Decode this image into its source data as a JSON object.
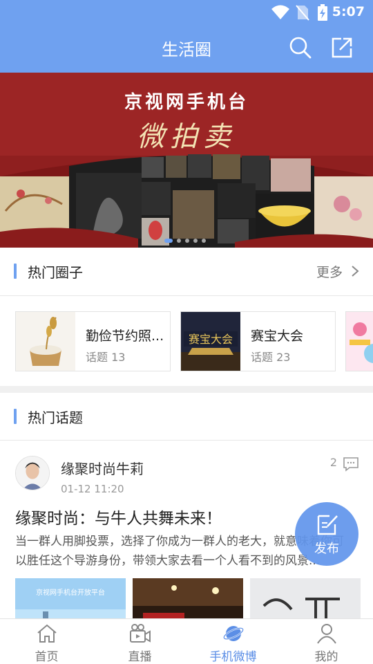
{
  "status_bar": {
    "time": "5:07"
  },
  "header": {
    "title": "生活圈"
  },
  "banner": {
    "title": "京视网手机台",
    "subtitle": "微拍卖",
    "dot_count": 5,
    "active_dot": 0
  },
  "hot_circles": {
    "title": "热门圈子",
    "more_label": "更多",
    "items": [
      {
        "name": "勤俭节约照...",
        "count_label": "话题",
        "count": "13"
      },
      {
        "name": "赛宝大会",
        "count_label": "话题",
        "count": "23"
      }
    ]
  },
  "hot_topics": {
    "title": "热门话题",
    "post": {
      "author": "缘聚时尚牛莉",
      "time": "01-12 11:20",
      "comment_count": "2",
      "title": "缘聚时尚：与牛人共舞未来！",
      "body": "当一群人用脚投票，选择了你成为一群人的老大，就意味着你可以胜任这个导游身份，带领大家去看一个人看不到的风景..."
    }
  },
  "publish_button": {
    "label": "发布"
  },
  "tab_bar": {
    "items": [
      {
        "label": "首页",
        "icon": "home-icon"
      },
      {
        "label": "直播",
        "icon": "video-camera-icon"
      },
      {
        "label": "手机微博",
        "icon": "planet-icon"
      },
      {
        "label": "我的",
        "icon": "user-icon"
      }
    ],
    "active_index": 2
  },
  "colors": {
    "accent": "#6fa1f0",
    "active_tab": "#5b8ee6"
  }
}
